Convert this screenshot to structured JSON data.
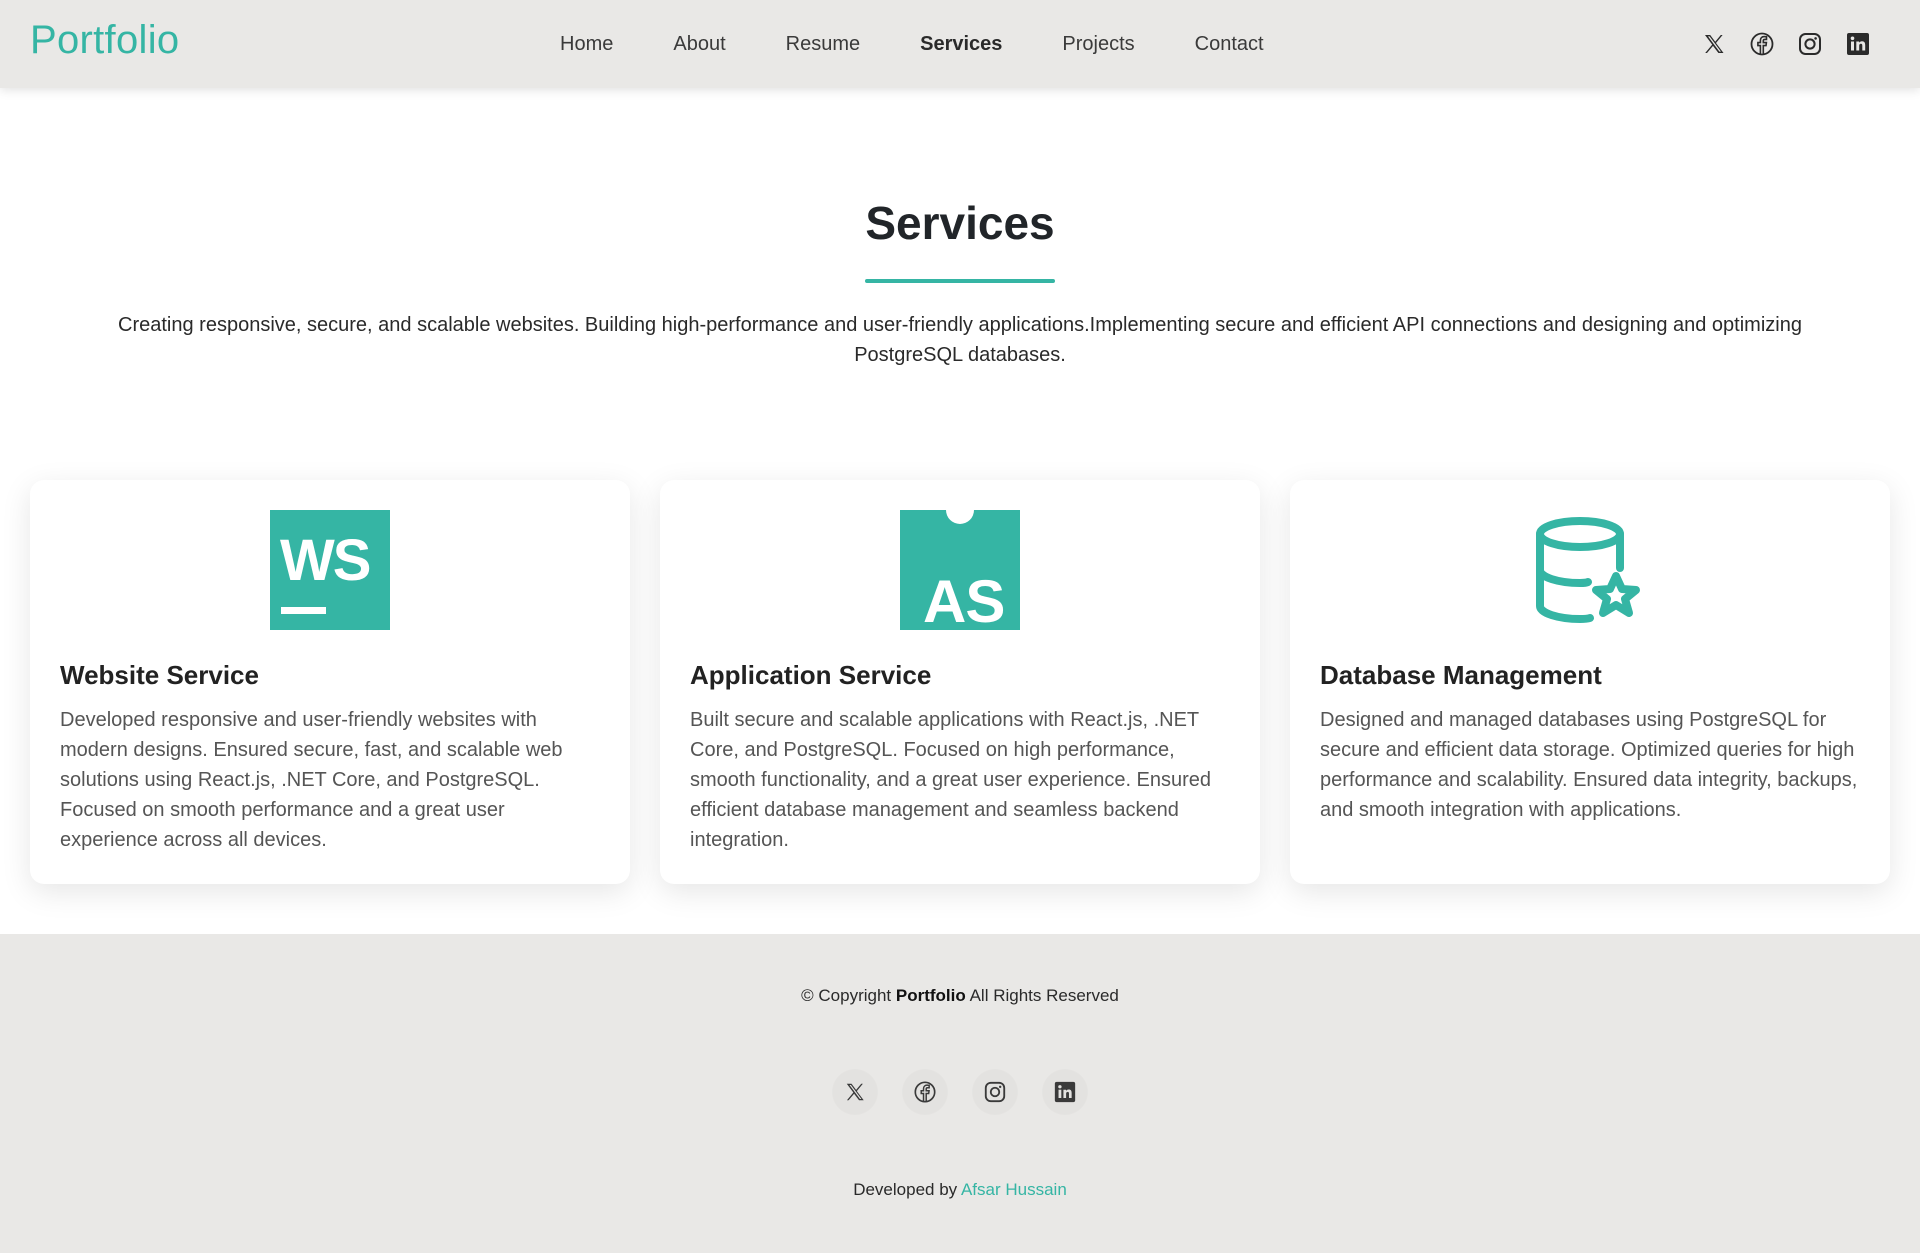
{
  "header": {
    "logo": "Portfolio",
    "nav": [
      {
        "label": "Home"
      },
      {
        "label": "About"
      },
      {
        "label": "Resume"
      },
      {
        "label": "Services",
        "active": true
      },
      {
        "label": "Projects"
      },
      {
        "label": "Contact"
      }
    ],
    "social_icons": [
      "x-icon",
      "facebook-icon",
      "instagram-icon",
      "linkedin-icon"
    ]
  },
  "section": {
    "title": "Services",
    "description": "Creating responsive, secure, and scalable websites. Building high-performance and user-friendly applications.Implementing secure and efficient API connections and designing and optimizing PostgreSQL databases."
  },
  "cards": [
    {
      "icon": "webstorm-icon",
      "icon_text": "WS",
      "title": "Website Service",
      "text": "Developed responsive and user-friendly websites with modern designs. Ensured secure, fast, and scalable web solutions using React.js, .NET Core, and PostgreSQL. Focused on smooth performance and a great user experience across all devices."
    },
    {
      "icon": "appcode-icon",
      "icon_text": "AS",
      "title": "Application Service",
      "text": "Built secure and scalable applications with React.js, .NET Core, and PostgreSQL. Focused on high performance, smooth functionality, and a great user experience. Ensured efficient database management and seamless backend integration."
    },
    {
      "icon": "database-star-icon",
      "title": "Database Management",
      "text": "Designed and managed databases using PostgreSQL for secure and efficient data storage. Optimized queries for high performance and scalability. Ensured data integrity, backups, and smooth integration with applications."
    }
  ],
  "footer": {
    "copyright_prefix": "© Copyright",
    "copyright_brand": "Portfolio",
    "copyright_suffix": "All Rights Reserved",
    "developed_prefix": "Developed by",
    "developer_name": "Afsar Hussain",
    "social_icons": [
      "x-icon",
      "facebook-icon",
      "instagram-icon",
      "linkedin-icon"
    ]
  },
  "colors": {
    "accent": "#35b5a4",
    "header_bg": "#e9e8e6",
    "footer_bg": "#e9e8e6",
    "text": "#212529"
  }
}
